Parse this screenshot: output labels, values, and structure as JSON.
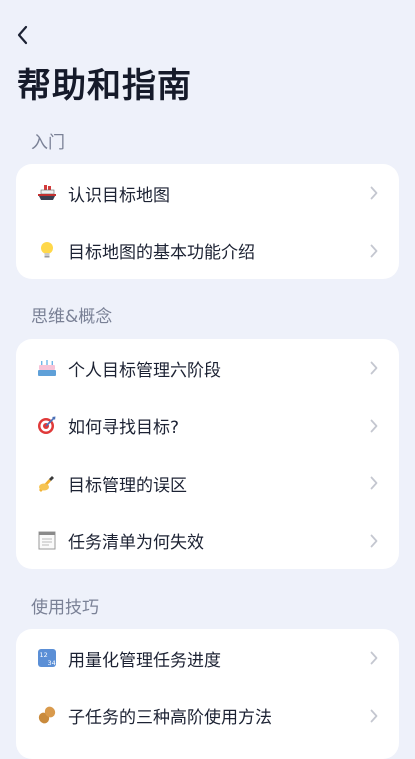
{
  "header": {
    "back_icon": "chevron-left-icon",
    "title": "帮助和指南"
  },
  "sections": [
    {
      "label": "入门",
      "items": [
        {
          "icon": "ship-icon",
          "label": "认识目标地图"
        },
        {
          "icon": "lightbulb-icon",
          "label": "目标地图的基本功能介绍"
        }
      ]
    },
    {
      "label": "思维&概念",
      "items": [
        {
          "icon": "cake-icon",
          "label": "个人目标管理六阶段"
        },
        {
          "icon": "target-icon",
          "label": "如何寻找目标?"
        },
        {
          "icon": "writing-hand-icon",
          "label": "目标管理的误区"
        },
        {
          "icon": "notepad-icon",
          "label": "任务清单为何失效"
        }
      ]
    },
    {
      "label": "使用技巧",
      "items": [
        {
          "icon": "numbers-icon",
          "label": "用量化管理任务进度"
        },
        {
          "icon": "peanut-icon",
          "label": "子任务的三种高阶使用方法"
        }
      ]
    }
  ],
  "colors": {
    "background": "#eef1fa",
    "card": "#ffffff",
    "section_label": "#7a8196",
    "chevron": "#c4c7d0"
  }
}
